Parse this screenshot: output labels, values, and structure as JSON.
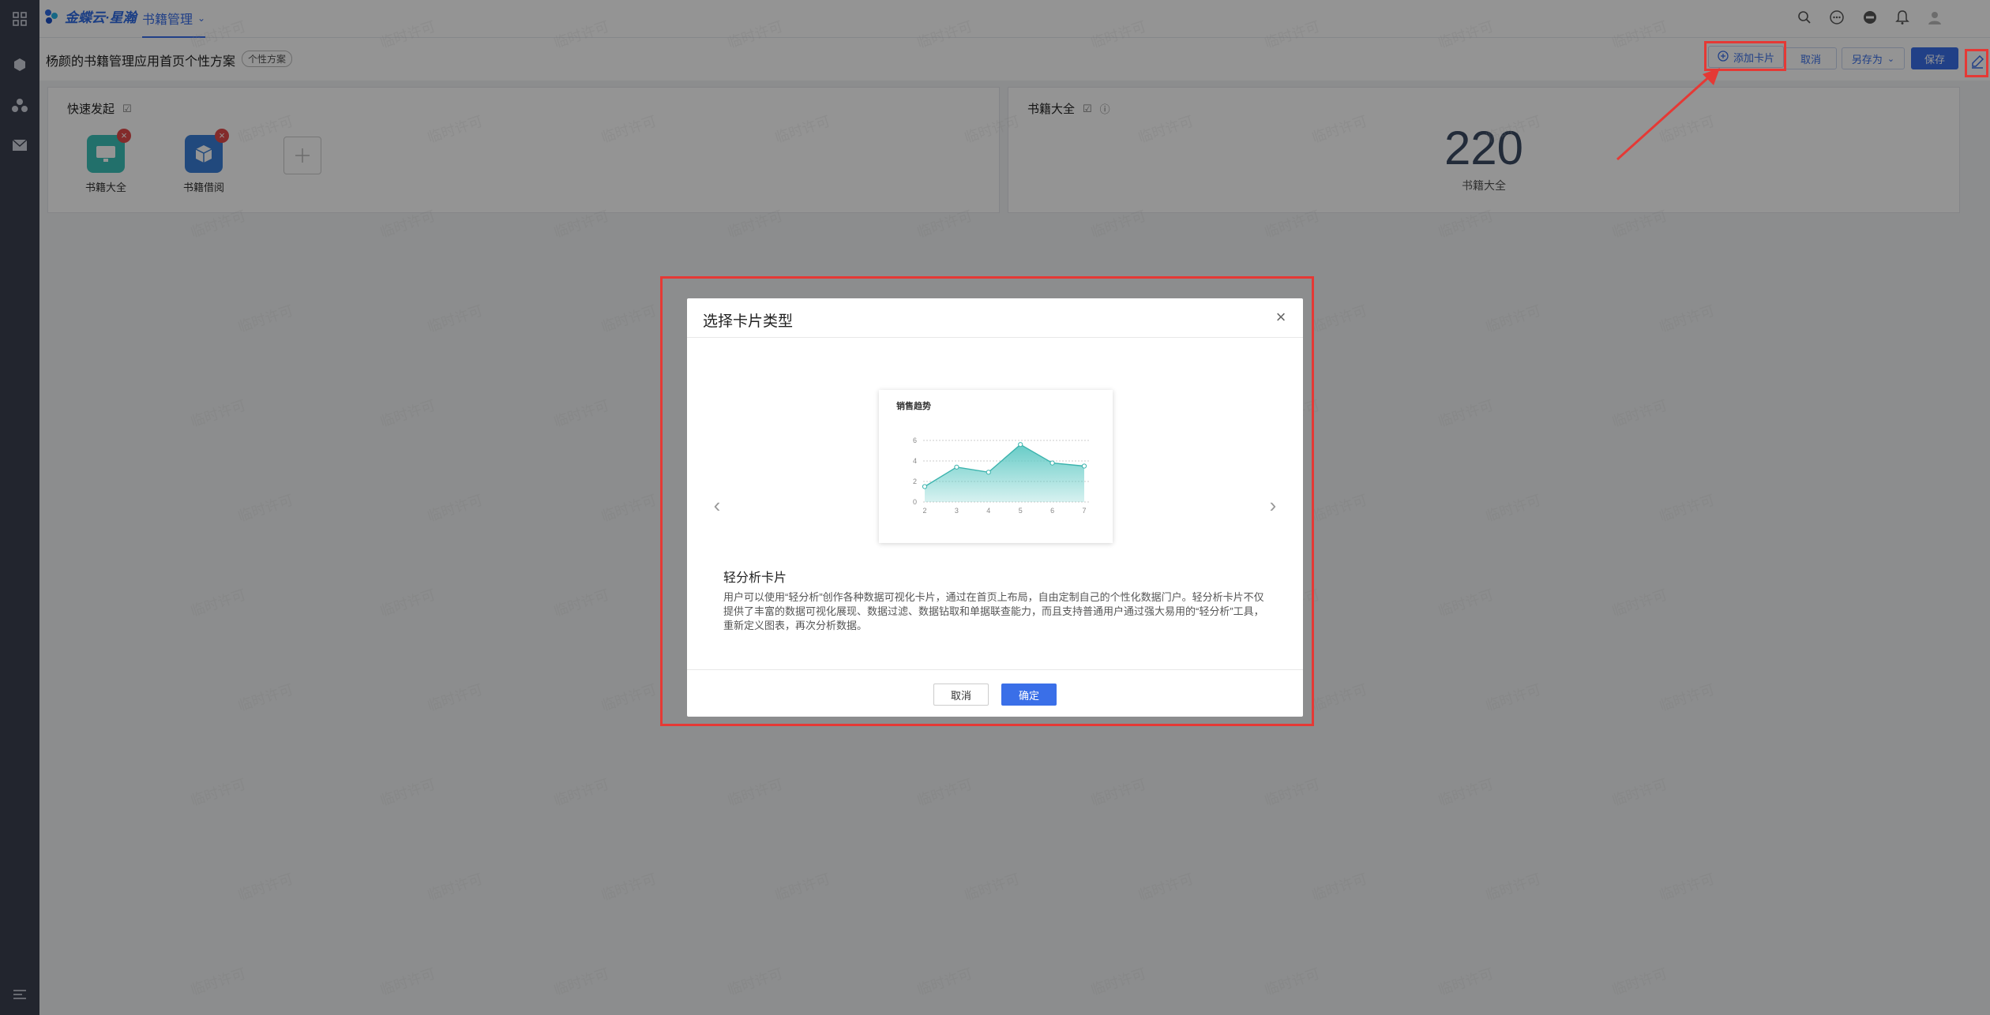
{
  "topbar": {
    "brand": "金蝶云·星瀚",
    "module_tab": "书籍管理"
  },
  "toolbar": {
    "page_title": "杨颜的书籍管理应用首页个性方案",
    "scheme_tag": "个性方案",
    "add_card": "添加卡片",
    "cancel": "取消",
    "save_as": "另存为",
    "save": "保存"
  },
  "cards": {
    "quick_launch": {
      "title": "快速发起",
      "apps": [
        {
          "label": "书籍大全"
        },
        {
          "label": "书籍借阅"
        }
      ]
    },
    "book_stat": {
      "title": "书籍大全",
      "value": "220",
      "caption": "书籍大全"
    }
  },
  "modal": {
    "title": "选择卡片类型",
    "card_name": "轻分析卡片",
    "card_desc": "用户可以使用“轻分析”创作各种数据可视化卡片，通过在首页上布局，自由定制自己的个性化数据门户。轻分析卡片不仅提供了丰富的数据可视化展现、数据过滤、数据钻取和单据联查能力，而且支持普通用户通过强大易用的“轻分析”工具，重新定义图表，再次分析数据。",
    "cancel": "取消",
    "confirm": "确定"
  },
  "watermark": "临时许可",
  "colors": {
    "accent": "#3a6fe8",
    "sidebar": "#3c4150",
    "annotation": "#e53935",
    "chart_fill": "#5fc9c4"
  },
  "chart_data": {
    "type": "area",
    "title": "销售趋势",
    "x": [
      2,
      3,
      4,
      5,
      6,
      7
    ],
    "series": [
      {
        "values": [
          1.5,
          3.4,
          2.9,
          5.6,
          3.8,
          3.5
        ]
      }
    ],
    "xlabel": "",
    "ylabel": "",
    "xlim": [
      2,
      7
    ],
    "ylim": [
      0,
      6
    ],
    "yticks": [
      "0",
      "2",
      "4",
      "6"
    ],
    "xticks": [
      "2",
      "3",
      "4",
      "5",
      "6",
      "7"
    ],
    "grid": true
  }
}
